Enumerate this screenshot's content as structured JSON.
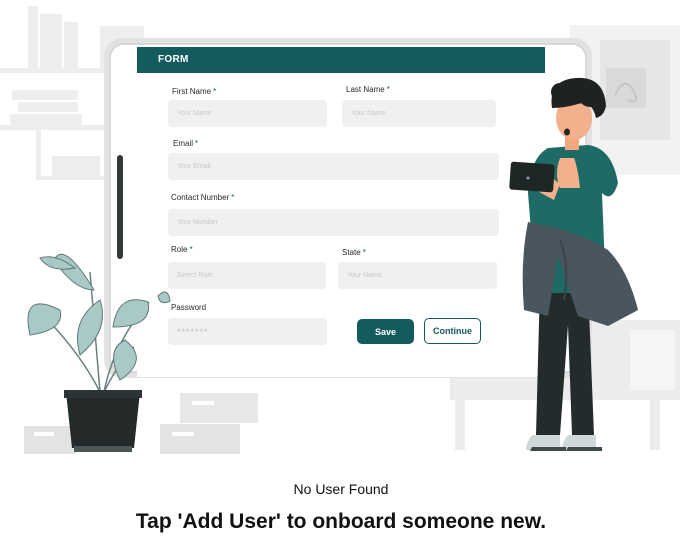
{
  "form": {
    "title": "FORM",
    "fields": {
      "first_name": {
        "label": "First Name",
        "placeholder": "Your Name",
        "required": "*"
      },
      "last_name": {
        "label": "Last Name",
        "placeholder": "Your Name",
        "required": "*"
      },
      "email": {
        "label": "Email",
        "placeholder": "Your Email",
        "required": "*"
      },
      "contact": {
        "label": "Contact  Number",
        "placeholder": "Your Number",
        "required": "*"
      },
      "role": {
        "label": "Role",
        "placeholder": "Select Role",
        "required": "*"
      },
      "state": {
        "label": "State",
        "placeholder": "Your Name",
        "required": "*"
      },
      "password": {
        "label": "Password",
        "placeholder": "*******"
      }
    },
    "save_label": "Save",
    "continue_label": "Continue"
  },
  "empty_state": {
    "title": "No User Found",
    "message": "Tap 'Add User' to onboard someone new."
  },
  "colors": {
    "brand": "#145b5d",
    "person_sweater": "#1e6b66",
    "jacket": "#4a565d",
    "pants": "#232b2c",
    "plant_leaf": "#a9c9c7",
    "background_shapes": "#ededed"
  }
}
